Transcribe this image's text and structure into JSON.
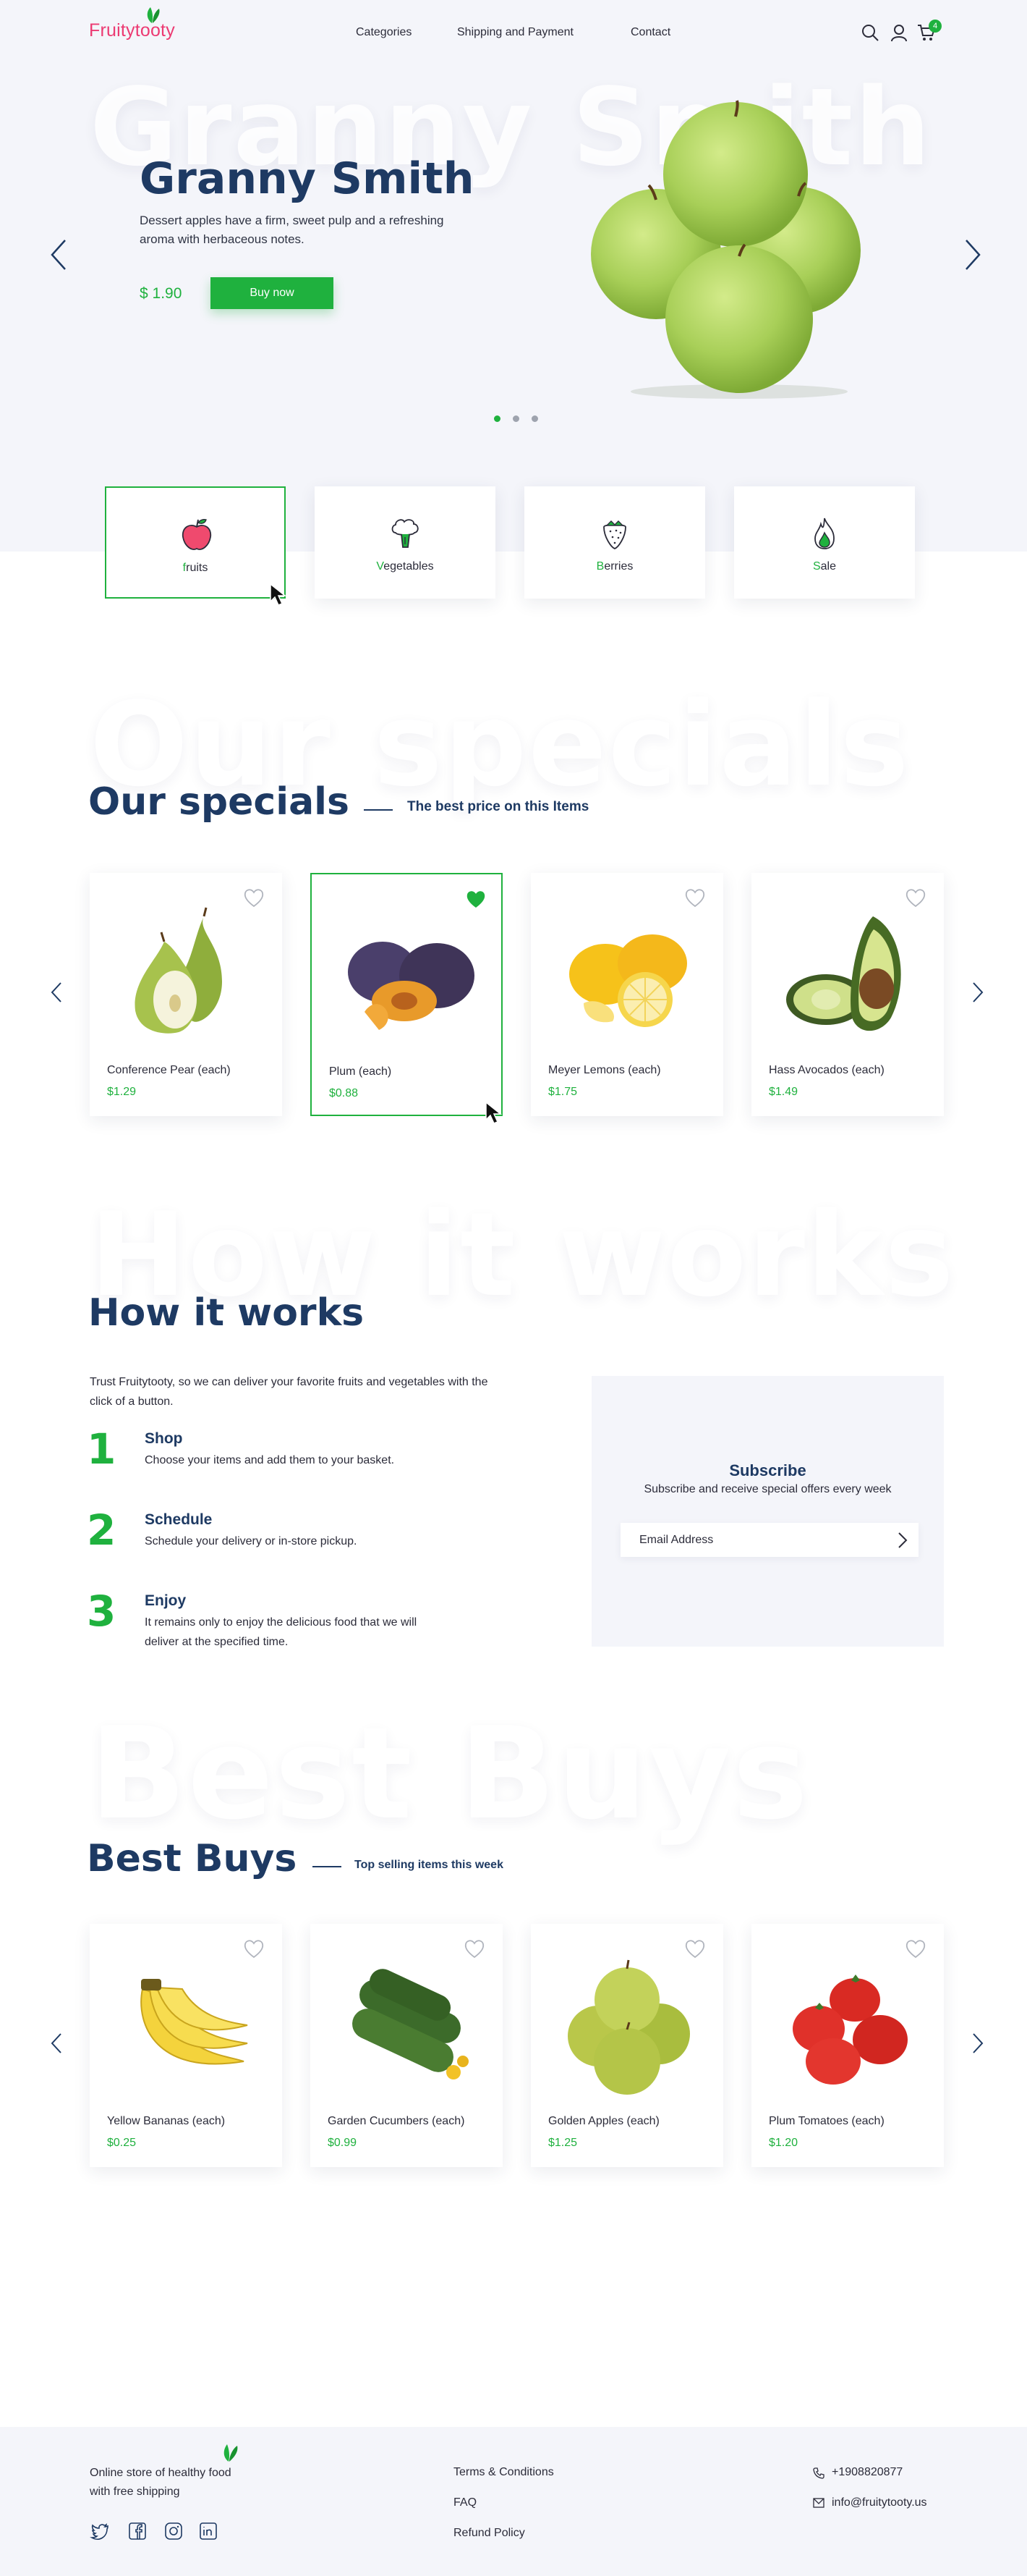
{
  "header": {
    "logo": "Fruitytooty",
    "nav": [
      "Categories",
      "Shipping and Payment",
      "Contact"
    ],
    "cart_count": "4"
  },
  "hero": {
    "ghost_text": "Granny Smith",
    "title": "Granny Smith",
    "description": "Dessert apples have a firm, sweet pulp and a refreshing aroma with herbaceous notes.",
    "price": "$ 1.90",
    "buy_label": "Buy now"
  },
  "categories": [
    {
      "first": "f",
      "rest": "ruits",
      "icon": "apple-icon"
    },
    {
      "first": "V",
      "rest": "egetables",
      "icon": "broccoli-icon"
    },
    {
      "first": "B",
      "rest": "erries",
      "icon": "strawberry-icon"
    },
    {
      "first": "S",
      "rest": "ale",
      "icon": "fire-icon"
    }
  ],
  "specials": {
    "ghost_text": "Our specials",
    "title": "Our specials",
    "subtitle": "The best price on this Items",
    "items": [
      {
        "name": "Conference Pear (each)",
        "price": "$1.29"
      },
      {
        "name": "Plum (each)",
        "price": "$0.88"
      },
      {
        "name": "Meyer Lemons (each)",
        "price": "$1.75"
      },
      {
        "name": "Hass Avocados (each)",
        "price": "$1.49"
      }
    ]
  },
  "how": {
    "ghost_text": "How it works",
    "title": "How it works",
    "intro": "Trust Fruitytooty, so we can deliver your favorite fruits and vegetables with the click of a button.",
    "steps": [
      {
        "num": "1",
        "title": "Shop",
        "desc": "Choose your items and add them to your basket."
      },
      {
        "num": "2",
        "title": "Schedule",
        "desc": "Schedule your delivery or in-store pickup."
      },
      {
        "num": "3",
        "title": "Enjoy",
        "desc": "It remains only to enjoy the delicious food that we will deliver at the specified time."
      }
    ]
  },
  "subscribe": {
    "title": "Subscribe",
    "desc": "Subscribe and receive special offers every week",
    "placeholder": "Email Address"
  },
  "best": {
    "ghost_text": "Best Buys",
    "title": "Best Buys",
    "subtitle": "Top selling items this week",
    "items": [
      {
        "name": "Yellow Bananas (each)",
        "price": "$0.25"
      },
      {
        "name": "Garden Cucumbers (each)",
        "price": "$0.99"
      },
      {
        "name": "Golden Apples (each)",
        "price": "$1.25"
      },
      {
        "name": "Plum Tomatoes (each)",
        "price": "$1.20"
      }
    ]
  },
  "footer": {
    "tagline_1": "Online store of healthy food",
    "tagline_2": "with free shipping",
    "links": [
      "Terms & Conditions",
      "FAQ",
      "Refund Policy"
    ],
    "phone": "+1908820877",
    "email": "info@fruitytooty.us",
    "social": [
      "twitter-icon",
      "facebook-icon",
      "instagram-icon",
      "linkedin-icon"
    ]
  },
  "colors": {
    "accent_green": "#1fb13e",
    "brand_pink": "#ec3a72",
    "heading_navy": "#1e3a63",
    "light_bg": "#f4f5fa"
  }
}
